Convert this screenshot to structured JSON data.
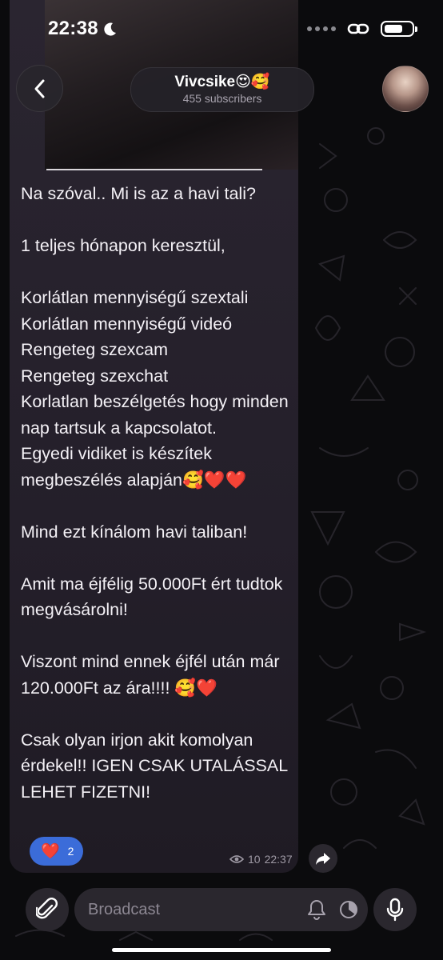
{
  "status_bar": {
    "time": "22:38"
  },
  "header": {
    "channel_name": "Vivcsike😍🥰",
    "subscribers": "455 subscribers"
  },
  "message": {
    "text": "Na szóval.. Mi is az a havi tali?\n\n1 teljes hónapon keresztül,\n\nKorlátlan mennyiségű szextali\nKorlátlan mennyiségű videó\nRengeteg szexcam\nRengeteg szexchat\nKorlatlan beszélgetés hogy minden nap tartsuk a kapcsolatot.\nEgyedi vidiket is készítek megbeszélés alapján🥰❤️❤️\n\nMind ezt kínálom havi taliban!\n\nAmit ma éjfélig 50.000Ft ért tudtok megvásárolni!\n\nViszont mind ennek éjfél után már 120.000Ft az ára!!!! 🥰❤️\n\nCsak olyan irjon akit komolyan érdekel!! IGEN CSAK UTALÁSSAL LEHET FIZETNI!",
    "reaction": {
      "emoji": "❤️",
      "count": "2"
    },
    "views": "10",
    "time": "22:37"
  },
  "composer": {
    "placeholder": "Broadcast"
  },
  "icons": {
    "back": "chevron-left-icon",
    "moon": "moon-icon",
    "link": "link-icon",
    "battery": "battery-icon",
    "eye": "eye-icon",
    "forward": "forward-icon",
    "attach": "paperclip-icon",
    "bell": "bell-icon",
    "schedule": "clock-icon",
    "mic": "microphone-icon"
  },
  "colors": {
    "background": "#0b0b0d",
    "bubble": "#2a2530",
    "reaction": "#3b6cd9",
    "secondary_text": "#9d98a3"
  }
}
